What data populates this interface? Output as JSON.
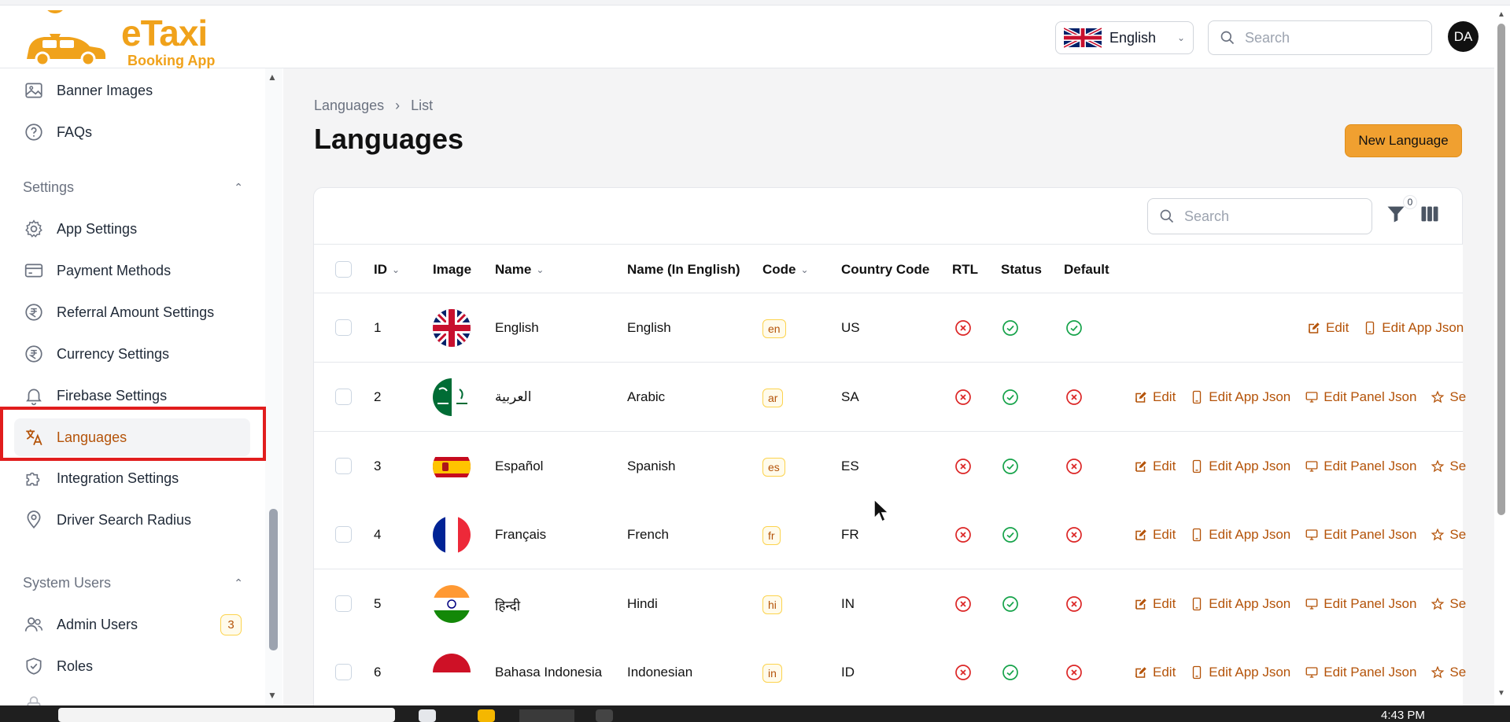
{
  "app": {
    "name": "eTaxi",
    "subtitle": "Booking App"
  },
  "header": {
    "language": "English",
    "search_placeholder": "Search",
    "avatar_initials": "DA"
  },
  "sidebar": {
    "items_top": [
      {
        "label": "Banner Images",
        "icon": "image-icon"
      },
      {
        "label": "FAQs",
        "icon": "question-circle-icon"
      }
    ],
    "group_settings": "Settings",
    "settings_items": [
      {
        "label": "App Settings",
        "icon": "gear-icon"
      },
      {
        "label": "Payment Methods",
        "icon": "credit-card-icon"
      },
      {
        "label": "Referral Amount Settings",
        "icon": "rupee-circle-icon"
      },
      {
        "label": "Currency Settings",
        "icon": "rupee-circle-icon"
      },
      {
        "label": "Firebase Settings",
        "icon": "bell-icon"
      },
      {
        "label": "Languages",
        "icon": "translate-icon",
        "active": true
      },
      {
        "label": "Integration Settings",
        "icon": "puzzle-icon"
      },
      {
        "label": "Driver Search Radius",
        "icon": "map-pin-icon"
      }
    ],
    "group_system_users": "System Users",
    "system_items": [
      {
        "label": "Admin Users",
        "icon": "users-icon",
        "badge": "3"
      },
      {
        "label": "Roles",
        "icon": "shield-check-icon"
      }
    ]
  },
  "breadcrumb": [
    "Languages",
    "List"
  ],
  "page_title": "Languages",
  "new_button": "New Language",
  "table": {
    "search_placeholder": "Search",
    "filter_count": "0",
    "columns": [
      "ID",
      "Image",
      "Name",
      "Name (In English)",
      "Code",
      "Country Code",
      "RTL",
      "Status",
      "Default"
    ],
    "actions": {
      "edit": "Edit",
      "edit_app_json": "Edit App Json",
      "edit_panel_json": "Edit Panel Json",
      "set_default": "Se"
    },
    "rows": [
      {
        "id": "1",
        "flag": "uk",
        "name": "English",
        "name_en": "English",
        "code": "en",
        "country": "US",
        "rtl": false,
        "status": true,
        "default": true
      },
      {
        "id": "2",
        "flag": "sa",
        "name": "العربية",
        "name_en": "Arabic",
        "code": "ar",
        "country": "SA",
        "rtl": false,
        "status": true,
        "default": false
      },
      {
        "id": "3",
        "flag": "es",
        "name": "Español",
        "name_en": "Spanish",
        "code": "es",
        "country": "ES",
        "rtl": false,
        "status": true,
        "default": false
      },
      {
        "id": "4",
        "flag": "fr",
        "name": "Français",
        "name_en": "French",
        "code": "fr",
        "country": "FR",
        "rtl": false,
        "status": true,
        "default": false
      },
      {
        "id": "5",
        "flag": "in",
        "name": "हिन्दी",
        "name_en": "Hindi",
        "code": "hi",
        "country": "IN",
        "rtl": false,
        "status": true,
        "default": false
      },
      {
        "id": "6",
        "flag": "id",
        "name": "Bahasa Indonesia",
        "name_en": "Indonesian",
        "code": "in",
        "country": "ID",
        "rtl": false,
        "status": true,
        "default": false
      }
    ]
  },
  "taskbar": {
    "time": "4:43 PM"
  },
  "colors": {
    "accent": "#f0a030",
    "action": "#b45309",
    "error": "#dc2626",
    "success": "#16a34a",
    "highlight": "#e11d1d"
  }
}
